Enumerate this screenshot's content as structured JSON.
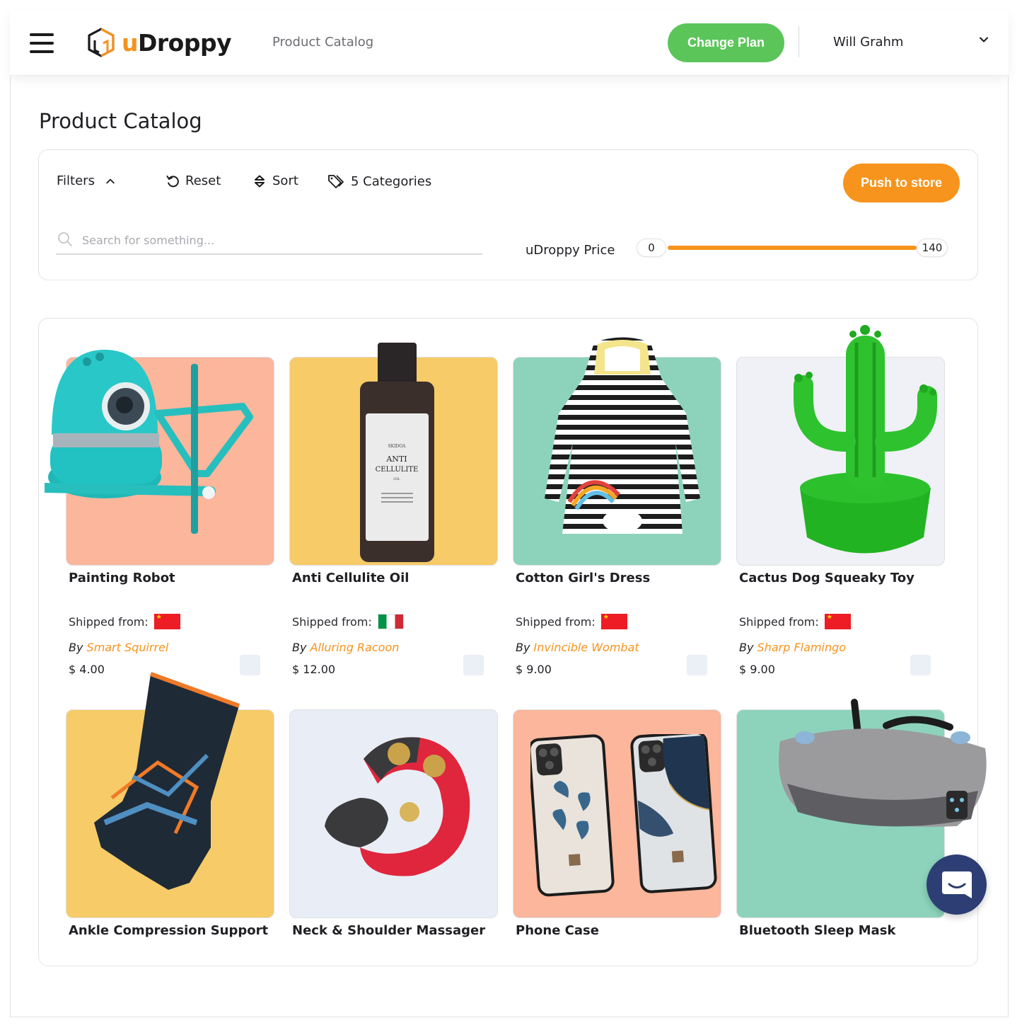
{
  "header": {
    "logo_u": "u",
    "logo_rest": "Droppy",
    "breadcrumb": "Product Catalog",
    "change_plan_label": "Change Plan",
    "user_name": "Will Grahm"
  },
  "page": {
    "title": "Product Catalog"
  },
  "filters": {
    "filters_label": "Filters",
    "reset_label": "Reset",
    "sort_label": "Sort",
    "categories_label": "5 Categories",
    "push_label": "Push to store",
    "search_placeholder": "Search for something...",
    "price_label": "uDroppy Price",
    "price_min": "0",
    "price_max": "140"
  },
  "labels": {
    "shipped_from": "Shipped from:",
    "by": "By"
  },
  "products": [
    {
      "name": "Painting Robot",
      "flag": "china",
      "seller": "Smart Squirrel",
      "price": "$ 4.00",
      "bg": "#fbb69b"
    },
    {
      "name": "Anti Cellulite Oil",
      "flag": "italy",
      "seller": "Alluring Racoon",
      "price": "$ 12.00",
      "bg": "#f6cb68"
    },
    {
      "name": "Cotton Girl's Dress",
      "flag": "china",
      "seller": "Invincible Wombat",
      "price": "$ 9.00",
      "bg": "#8dd3bc"
    },
    {
      "name": "Cactus Dog Squeaky Toy",
      "flag": "china",
      "seller": "Sharp Flamingo",
      "price": "$ 9.00",
      "bg": "#eff1f6"
    },
    {
      "name": "Ankle Compression Support",
      "bg": "#f6cb68"
    },
    {
      "name": "Neck & Shoulder Massager",
      "bg": "#e9eef6"
    },
    {
      "name": "Phone Case",
      "bg": "#fbb69b"
    },
    {
      "name": "Bluetooth Sleep Mask",
      "bg": "#8dd3bc"
    }
  ],
  "oil_label": {
    "brand": "SKIDOA",
    "line1": "ANTI",
    "line2": "CELLULITE",
    "line3": "OIL"
  },
  "colors": {
    "accent_orange": "#f7941d",
    "green": "#5cc55a",
    "chat": "#2c3e73"
  },
  "icons": [
    "menu-icon",
    "chevron-down-icon",
    "chevron-up-icon",
    "reset-icon",
    "sort-icon",
    "tag-icon",
    "search-icon",
    "chat-icon"
  ]
}
